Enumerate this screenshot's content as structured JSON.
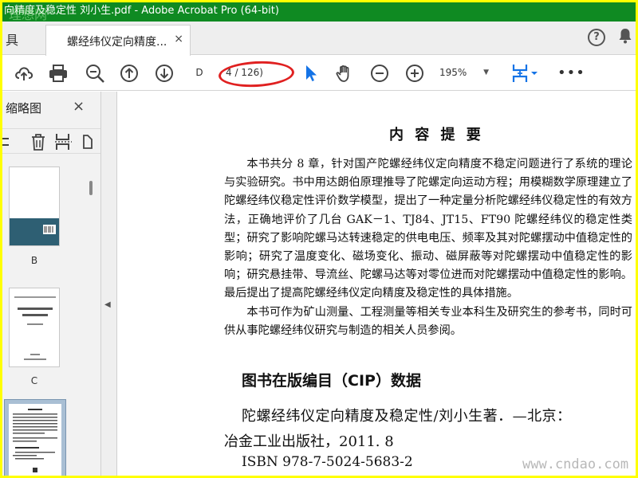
{
  "window": {
    "title": "向精度及稳定性 刘小生.pdf - Adobe Acrobat Pro (64-bit)",
    "watermark_top": "理想网"
  },
  "tabs": {
    "tools_label": "具",
    "document_tab_label": "螺经纬仪定向精度...",
    "close_symbol": "×"
  },
  "toolbar": {
    "page_input_value": "D",
    "page_count": "4 / 126)",
    "zoom_value": "195%",
    "more_symbol": "•••"
  },
  "sidebar": {
    "title": "缩略图",
    "close_symbol": "×",
    "thumbnails": [
      {
        "label": "B"
      },
      {
        "label": "C"
      },
      {
        "label": ""
      }
    ]
  },
  "document": {
    "heading": "内 容 提 要",
    "paragraphs": [
      "本书共分 8 章，针对国产陀螺经纬仪定向精度不稳定问题进行了系统的理论与实验研究。书中用达朗伯原理推导了陀螺定向运动方程；用模糊数学原理建立了陀螺经纬仪稳定性评价数学模型，提出了一种定量分析陀螺经纬仪稳定性的有效方法，正确地评价了几台 GAK－1、TJ84、JT15、FT90 陀螺经纬仪的稳定性类型；研究了影响陀螺马达转速稳定的供电电压、频率及其对陀螺摆动中值稳定性的影响；研究了温度变化、磁场变化、振动、磁屏蔽等对陀螺摆动中值稳定性的影响；研究悬挂带、导流丝、陀螺马达等对零位进而对陀螺摆动中值稳定性的影响。最后提出了提高陀螺经纬仪定向精度及稳定性的具体措施。",
      "本书可作为矿山测量、工程测量等相关专业本科生及研究生的参考书，同时可供从事陀螺经纬仪研究与制造的相关人员参阅。"
    ],
    "cip_title": "图书在版编目（CIP）数据",
    "cip_line1": "陀螺经纬仪定向精度及稳定性/刘小生著．—北京：",
    "cip_line2": "冶金工业出版社，2011. 8",
    "cip_isbn": "ISBN 978-7-5024-5683-2"
  },
  "watermark_bottom": "www.cndao.com",
  "colors": {
    "title_bar": "#0f8a22",
    "highlight_ellipse": "#e02020",
    "frame": "#ffff00",
    "icon_blue": "#1473e6"
  }
}
